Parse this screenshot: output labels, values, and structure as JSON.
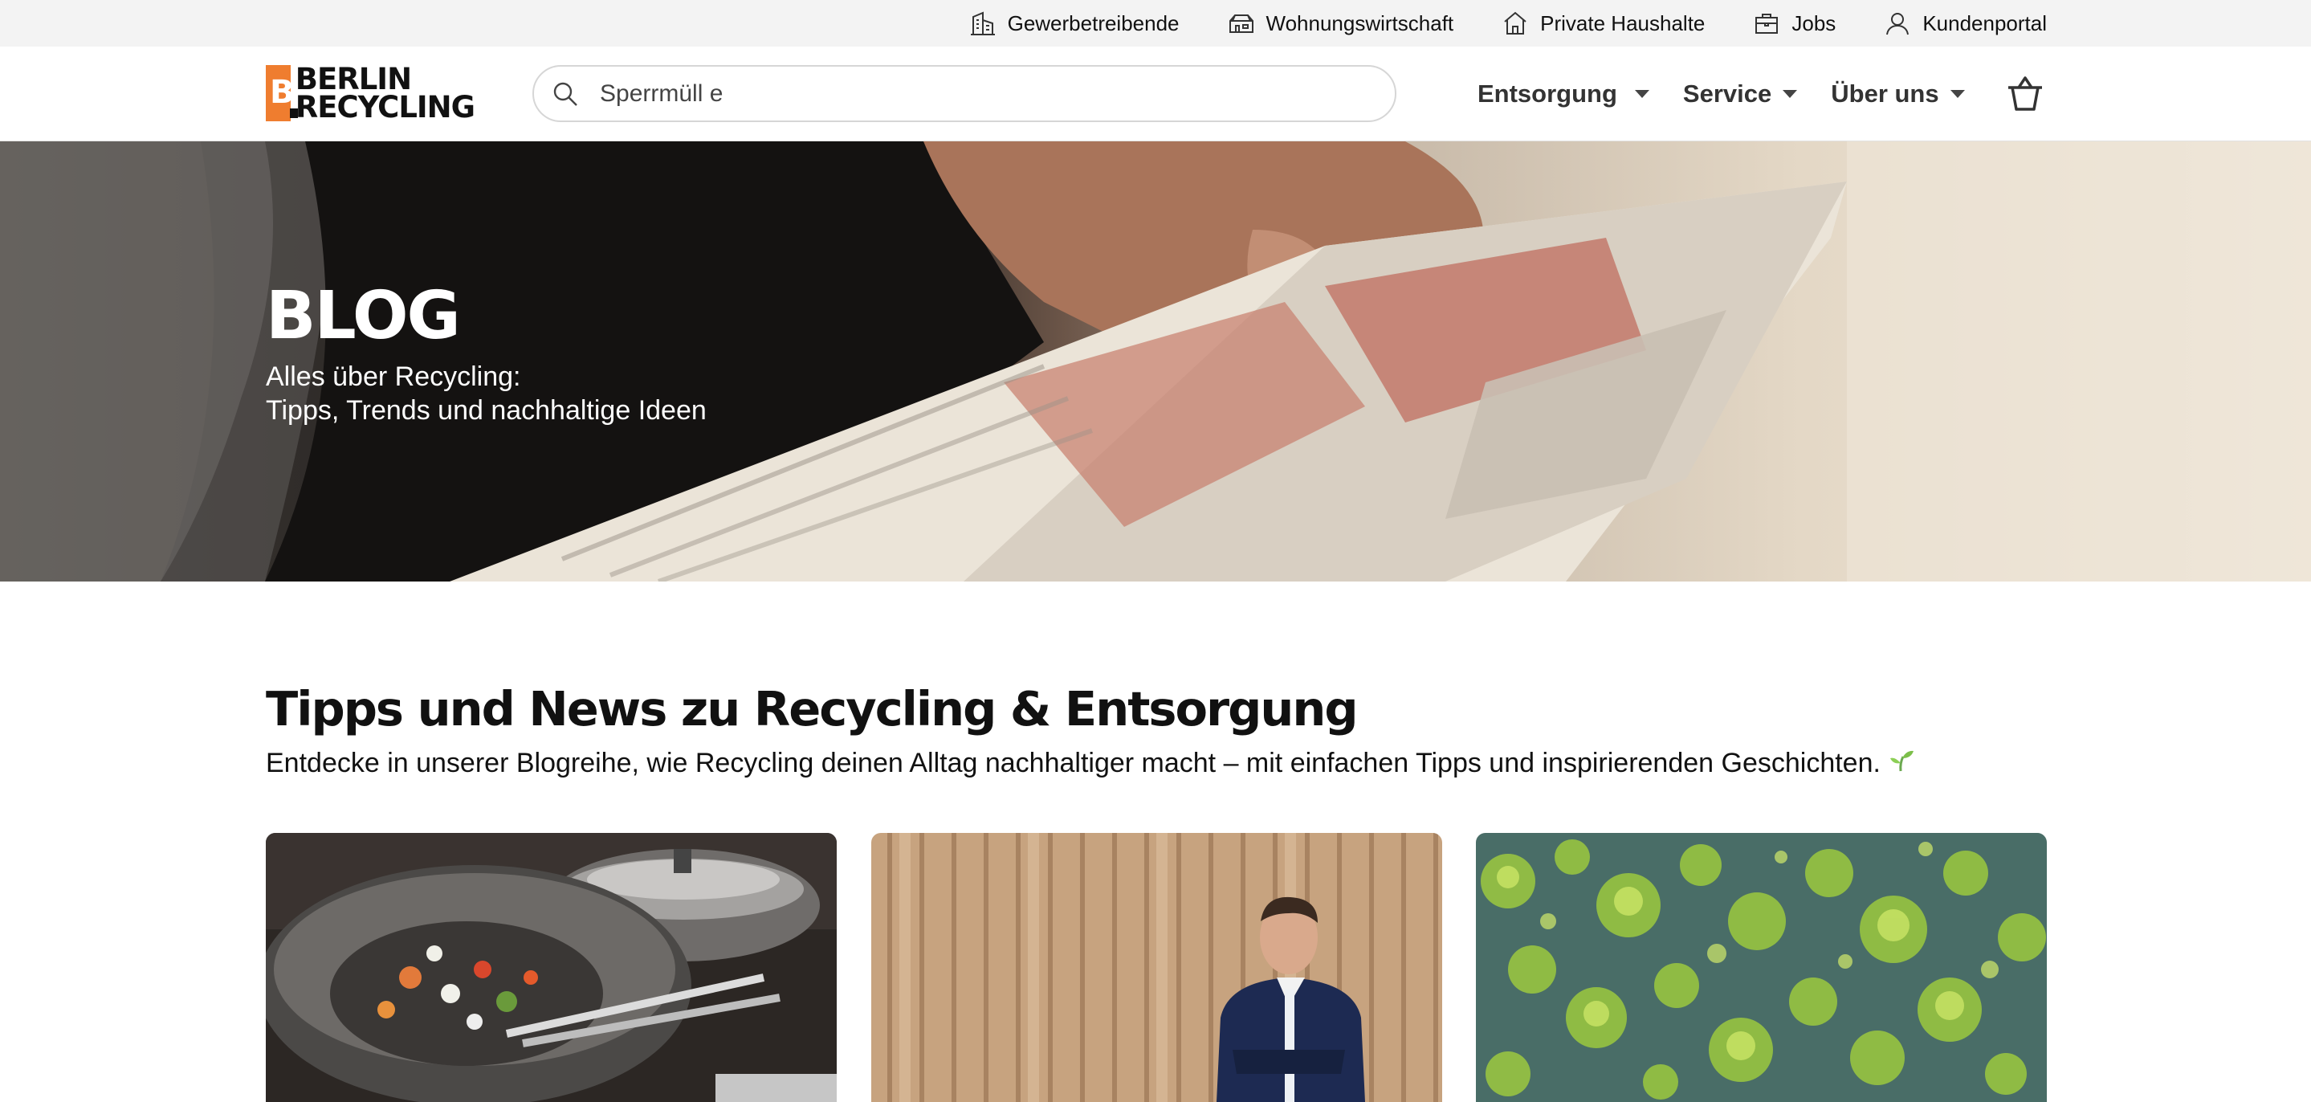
{
  "topbar": {
    "links": [
      {
        "label": "Gewerbetreibende",
        "icon": "building-icon"
      },
      {
        "label": "Wohnungswirtschaft",
        "icon": "apartment-icon"
      },
      {
        "label": "Private Haushalte",
        "icon": "house-icon"
      },
      {
        "label": "Jobs",
        "icon": "briefcase-icon"
      },
      {
        "label": "Kundenportal",
        "icon": "user-icon"
      }
    ]
  },
  "header": {
    "logo_line1": "BERLIN",
    "logo_line2": "RECYCLING",
    "logo_mark": "B",
    "search": {
      "value": "Sperrmüll e",
      "icon": "search-icon"
    },
    "nav": [
      {
        "label": "Entsorgung"
      },
      {
        "label": "Service"
      },
      {
        "label": "Über uns"
      }
    ],
    "cart_icon": "basket-icon"
  },
  "hero": {
    "title": "BLOG",
    "subtitle_line1": "Alles über Recycling:",
    "subtitle_line2": "Tipps, Trends und nachhaltige Ideen"
  },
  "section": {
    "title": "Tipps und News zu Recycling & Entsorgung",
    "text": "Entdecke in unserer Blogreihe, wie Recycling deinen Alltag nachhaltiger macht – mit einfachen Tipps und inspirierenden Geschichten.",
    "emoji_icon": "seedling-icon"
  },
  "colors": {
    "brand_orange": "#ef7d2f",
    "topbar_bg": "#f3f3f3",
    "text": "#111111"
  }
}
